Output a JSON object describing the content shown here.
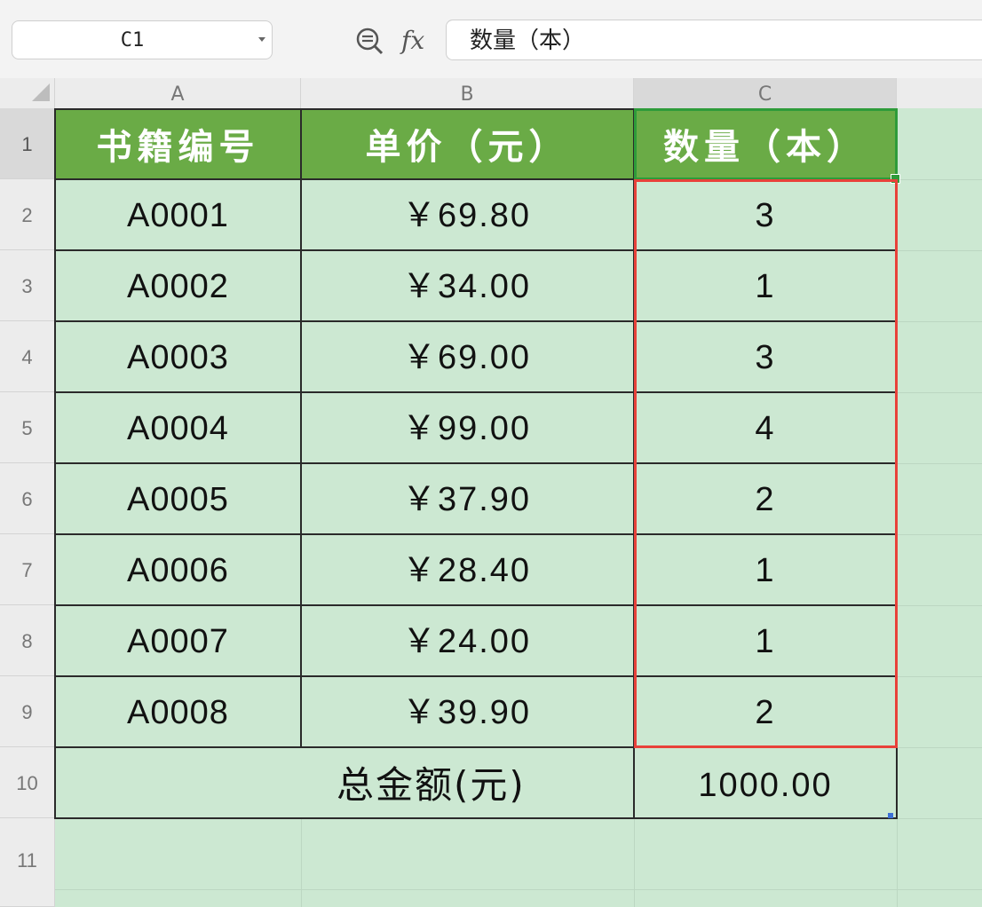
{
  "formula_bar": {
    "name_box": "C1",
    "fx_label": "fx",
    "formula": "数量（本）"
  },
  "columns": [
    "A",
    "B",
    "C"
  ],
  "rows": [
    "1",
    "2",
    "3",
    "4",
    "5",
    "6",
    "7",
    "8",
    "9",
    "10",
    "11"
  ],
  "headers": {
    "id": "书籍编号",
    "price": "单价（元）",
    "qty": "数量（本）"
  },
  "table": [
    {
      "id": "A0001",
      "price": "￥69.80",
      "qty": "3"
    },
    {
      "id": "A0002",
      "price": "￥34.00",
      "qty": "1"
    },
    {
      "id": "A0003",
      "price": "￥69.00",
      "qty": "3"
    },
    {
      "id": "A0004",
      "price": "￥99.00",
      "qty": "4"
    },
    {
      "id": "A0005",
      "price": "￥37.90",
      "qty": "2"
    },
    {
      "id": "A0006",
      "price": "￥28.40",
      "qty": "1"
    },
    {
      "id": "A0007",
      "price": "￥24.00",
      "qty": "1"
    },
    {
      "id": "A0008",
      "price": "￥39.90",
      "qty": "2"
    }
  ],
  "total": {
    "label": "总金额(元)",
    "value": "1000.00"
  },
  "colors": {
    "header_green": "#6aab46",
    "cell_green": "#cce8d2",
    "selection_green": "#2e9b3a",
    "highlight_red": "#e8413a"
  }
}
